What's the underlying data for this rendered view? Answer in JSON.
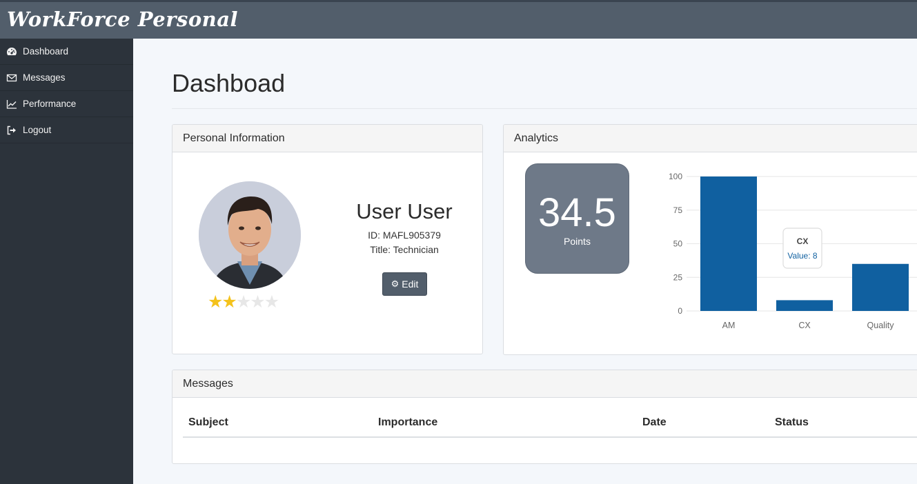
{
  "app": {
    "brand": "WorkForce Personal"
  },
  "sidebar": {
    "items": [
      {
        "label": "Dashboard",
        "icon": "dashboard-icon"
      },
      {
        "label": "Messages",
        "icon": "envelope-icon"
      },
      {
        "label": "Performance",
        "icon": "line-chart-icon"
      },
      {
        "label": "Logout",
        "icon": "logout-icon"
      }
    ]
  },
  "page": {
    "title": "Dashboad"
  },
  "personal": {
    "heading": "Personal Information",
    "name": "User User",
    "id_line": "ID: MAFL905379",
    "title_line": "Title: Technician",
    "edit_label": "Edit",
    "rating": 2,
    "rating_max": 5
  },
  "analytics": {
    "heading": "Analytics",
    "points_value": "34.5",
    "points_label": "Points"
  },
  "chart_data": {
    "type": "bar",
    "categories": [
      "AM",
      "CX",
      "Quality"
    ],
    "values": [
      100,
      8,
      35
    ],
    "ylim": [
      0,
      100
    ],
    "yticks": [
      0,
      25,
      50,
      75,
      100
    ],
    "grid": true,
    "bar_color": "#1060a0",
    "tooltip": {
      "title": "CX",
      "text": "Value: 8"
    }
  },
  "messages": {
    "heading": "Messages",
    "columns": [
      "Subject",
      "Importance",
      "Date",
      "Status"
    ]
  },
  "colors": {
    "topbar": "#525e6b",
    "sidebar": "#2c333b",
    "accent_bar": "#1060a0",
    "star": "#f4c21b"
  }
}
